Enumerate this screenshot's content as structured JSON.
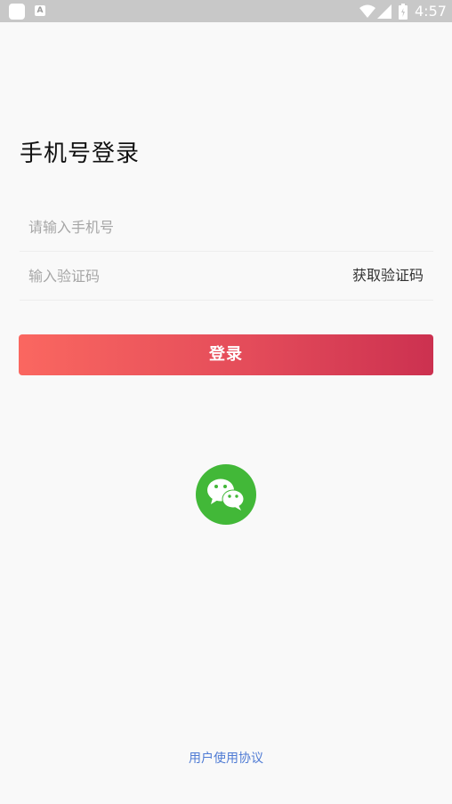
{
  "status_bar": {
    "app_icon": "notification-app-icon",
    "a_icon_label": "A",
    "wifi_icon": "wifi-icon",
    "signal_icon": "cell-signal-icon",
    "battery_icon": "battery-icon",
    "time": "4:57"
  },
  "page": {
    "title": "手机号登录"
  },
  "form": {
    "phone_placeholder": "请输入手机号",
    "phone_value": "",
    "code_placeholder": "输入验证码",
    "code_value": "",
    "get_code_label": "获取验证码",
    "login_label": "登录"
  },
  "social": {
    "wechat_icon": "wechat-icon"
  },
  "footer": {
    "agreement_label": "用户使用协议"
  },
  "colors": {
    "background": "#f9f9f9",
    "login_gradient_start": "#fa6760",
    "login_gradient_end": "#cc3150",
    "wechat_green": "#42b838",
    "link_blue": "#4f7bd4"
  }
}
